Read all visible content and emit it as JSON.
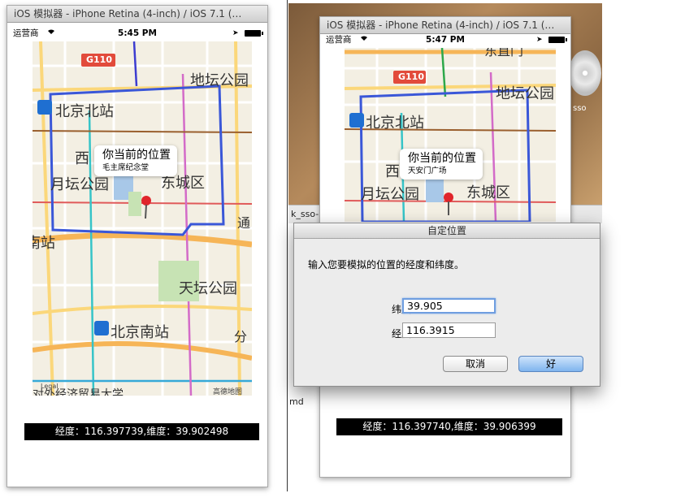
{
  "left_sim": {
    "title": "iOS 模拟器 - iPhone Retina (4-inch) / iOS 7.1 (…",
    "status": {
      "carrier": "运营商",
      "wifi_icon": "wifi-icon",
      "time": "5:45 PM"
    },
    "map": {
      "labels": {
        "highway": "G110",
        "beijing_north": "北京北站",
        "ditan": "地坛公园",
        "xi": "西",
        "yuetan": "月坛公园",
        "dongcheng": "东城区",
        "tong": "通",
        "nan_zhan": "南站",
        "tiantan": "天坛公园",
        "beijing_south": "北京南站",
        "fen": "分",
        "bottom": "对外经济贸易大学",
        "legal": "Legal",
        "gaode": "高德地图"
      }
    },
    "callout": {
      "title": "你当前的位置",
      "subtitle": "毛主席纪念堂"
    },
    "coords": "经度：116.397739,维度：39.902498"
  },
  "right_sim": {
    "title": "iOS 模拟器 - iPhone Retina (4-inch) / iOS 7.1 (…",
    "status": {
      "carrier": "运营商",
      "wifi_icon": "wifi-icon",
      "time": "5:47 PM"
    },
    "map": {
      "labels": {
        "top": "东直门",
        "highway": "G110",
        "ditan": "地坛公园",
        "beijing_north": "北京北站",
        "xi": "西",
        "yuetan": "月坛公园",
        "dongcheng": "东城区"
      }
    },
    "callout": {
      "title": "你当前的位置",
      "subtitle": "天安门广场"
    },
    "coords": "经度：116.397740,维度：39.906399"
  },
  "background": {
    "sso_text": "k_sso-",
    "sso_label": "sso",
    "md_text": "md"
  },
  "dialog": {
    "title": "自定位置",
    "message": "输入您要模拟的位置的经度和纬度。",
    "latitude_label": "纬度:",
    "latitude_value": "39.905",
    "longitude_label": "经度:",
    "longitude_value": "116.3915",
    "cancel_label": "取消",
    "ok_label": "好"
  },
  "colors": {
    "accent": "#7fb4ee",
    "ring_road": "#3a57d8",
    "highway": "#f5b84a"
  }
}
